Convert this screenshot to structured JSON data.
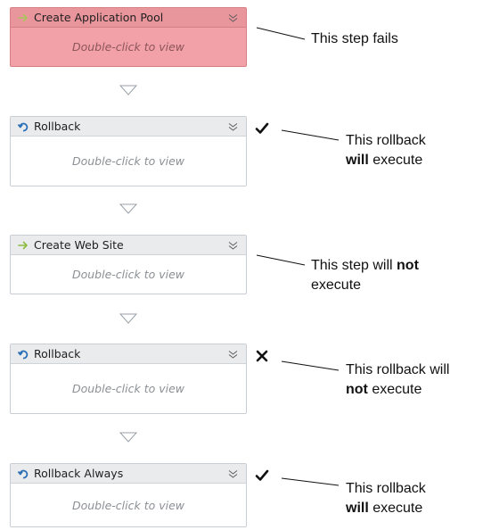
{
  "placeholder_text": "Double-click to view",
  "steps": [
    {
      "title": "Create Application Pool",
      "icon": "arrow-right-icon",
      "state": "failed"
    },
    {
      "title": "Rollback",
      "icon": "rollback-icon",
      "state": "normal"
    },
    {
      "title": "Create Web Site",
      "icon": "arrow-right-icon",
      "state": "normal"
    },
    {
      "title": "Rollback",
      "icon": "rollback-icon",
      "state": "normal"
    },
    {
      "title": "Rollback Always",
      "icon": "rollback-icon",
      "state": "normal"
    }
  ],
  "annotations": [
    {
      "lines": [
        [
          {
            "text": "This step fails",
            "bold": false
          }
        ]
      ]
    },
    {
      "mark": "check-icon",
      "lines": [
        [
          {
            "text": "This rollback",
            "bold": false
          }
        ],
        [
          {
            "text": "will",
            "bold": true
          },
          {
            "text": " execute",
            "bold": false
          }
        ]
      ]
    },
    {
      "lines": [
        [
          {
            "text": "This step will ",
            "bold": false
          },
          {
            "text": "not",
            "bold": true
          }
        ],
        [
          {
            "text": "execute",
            "bold": false
          }
        ]
      ]
    },
    {
      "mark": "cross-icon",
      "lines": [
        [
          {
            "text": "This rollback will",
            "bold": false
          }
        ],
        [
          {
            "text": "not",
            "bold": true
          },
          {
            "text": " execute",
            "bold": false
          }
        ]
      ]
    },
    {
      "mark": "check-icon",
      "lines": [
        [
          {
            "text": "This rollback",
            "bold": false
          }
        ],
        [
          {
            "text": "will",
            "bold": true
          },
          {
            "text": " execute",
            "bold": false
          }
        ]
      ]
    }
  ],
  "colors": {
    "failed_fill": "#f2a1a8",
    "failed_header": "#e9959c",
    "header_fill": "#e9ebed",
    "forward_arrow": "#8cbc3f",
    "rollback_icon": "#2b6fb6"
  }
}
